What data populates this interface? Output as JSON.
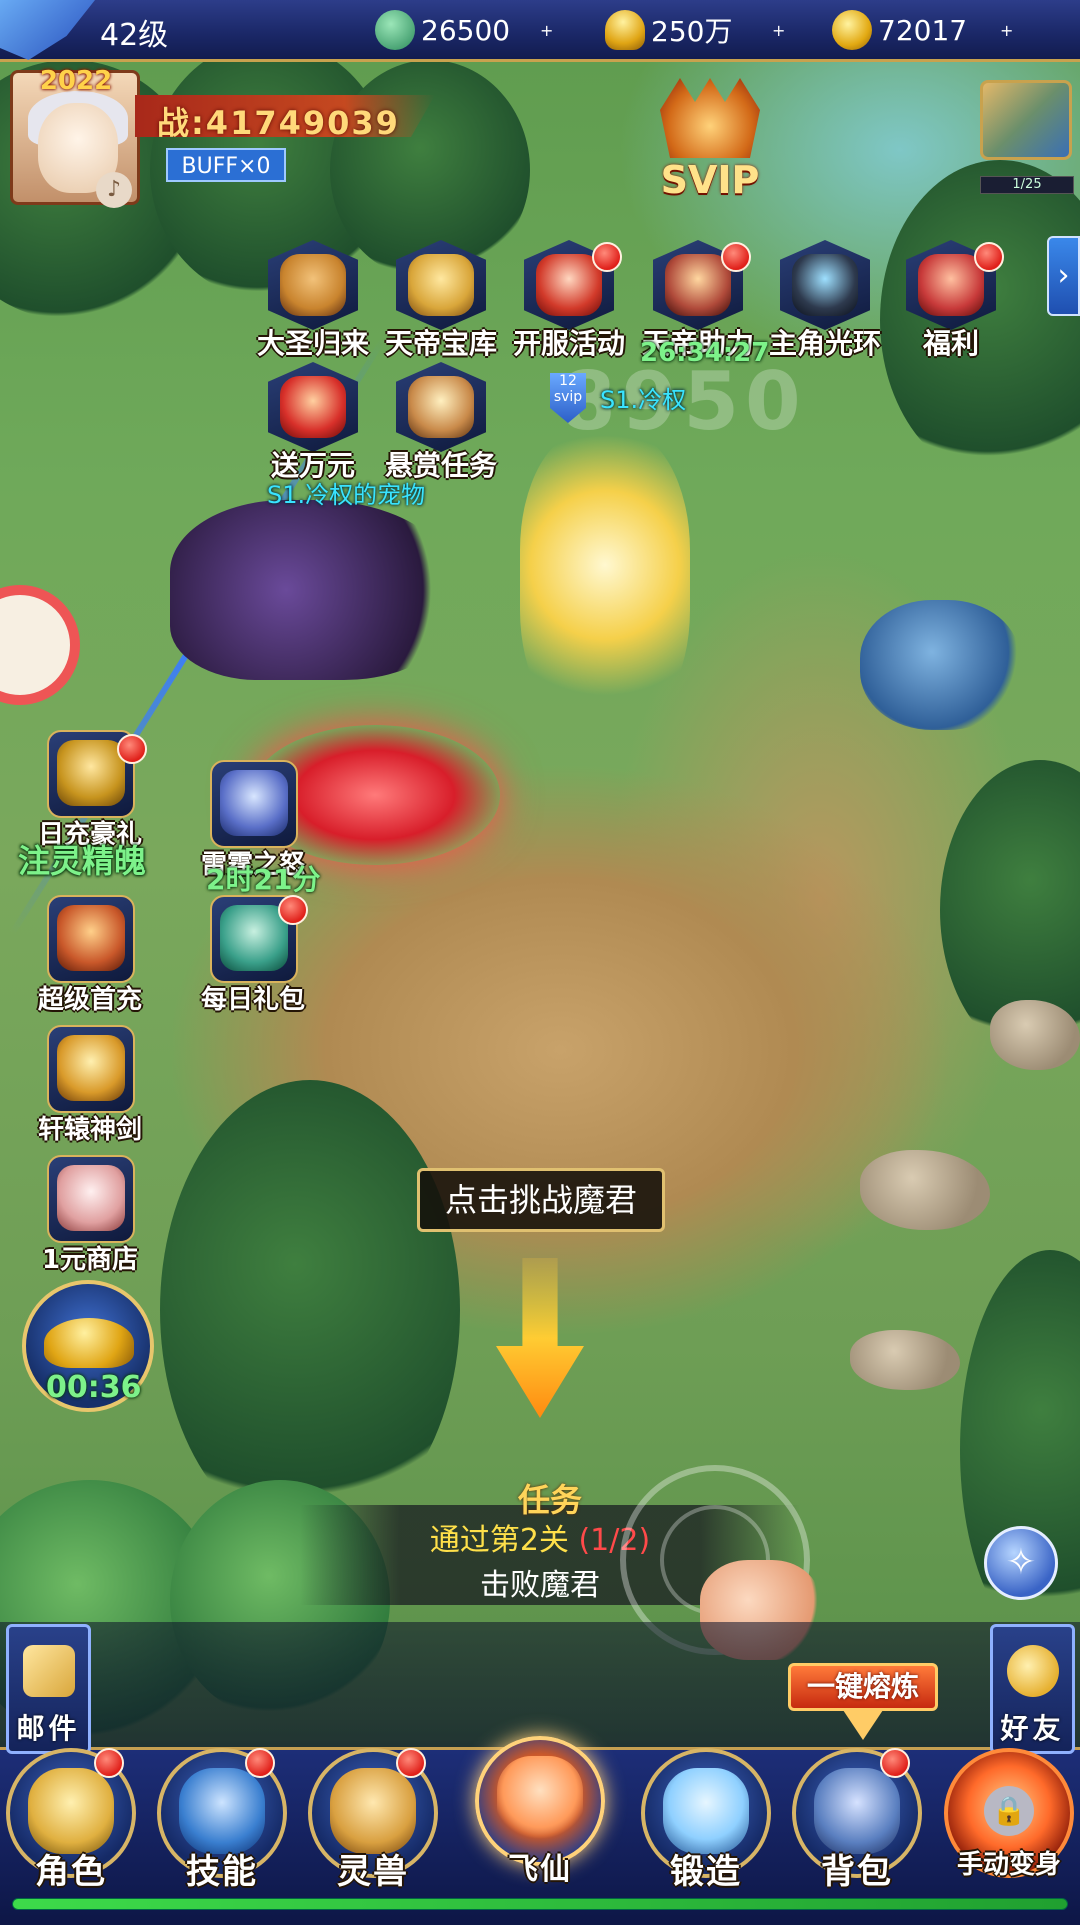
{
  "header": {
    "level": "42级",
    "resources": [
      {
        "name": "jade",
        "icon": "jade-icon",
        "value": "26500",
        "color": "#3aa36a"
      },
      {
        "name": "gold-ingot",
        "icon": "gold-ingot-icon",
        "value": "250万",
        "color": "#e9b52a"
      },
      {
        "name": "coin",
        "icon": "coin-icon",
        "value": "72017",
        "color": "#f2c230"
      }
    ],
    "plus_symbol": "+"
  },
  "player": {
    "year_badge": "2022",
    "power": "战:41749039",
    "buff": "BUFF×0",
    "speaker_icon": "speaker-icon"
  },
  "svip": {
    "label": "SVIP"
  },
  "map": {
    "progress": "1/25"
  },
  "activities": [
    {
      "label": "大圣归来",
      "icon": "monkey-king-icon",
      "color": "#c9842e",
      "dot": false
    },
    {
      "label": "天帝宝库",
      "icon": "treasure-beast-icon",
      "color": "#d9a63a",
      "dot": false
    },
    {
      "label": "开服活动",
      "icon": "open-server-icon",
      "color": "#d23a2a",
      "dot": true
    },
    {
      "label": "天帝助力",
      "icon": "sky-emperor-icon",
      "color": "#b04a3a",
      "dot": true
    },
    {
      "label": "主角光环",
      "icon": "hero-halo-icon",
      "color": "#2e3a4e",
      "dot": false
    },
    {
      "label": "福利",
      "icon": "fortune-bag-icon",
      "color": "#c83a3a",
      "dot": true
    },
    {
      "label": "送万元",
      "icon": "red-envelope-icon",
      "color": "#d8302a",
      "dot": false
    },
    {
      "label": "悬赏任务",
      "icon": "bounty-scroll-icon",
      "color": "#c98a4a",
      "dot": false
    }
  ],
  "timers": {
    "sky_emperor": "26:34:27",
    "thunder": "2时21分",
    "gold": "00:36"
  },
  "tags": {
    "player_name": "S1.冷权",
    "pet_name": "S1.冷权的宠物",
    "svip_level": "12",
    "svip_small": "svip",
    "ghost_number": "8950"
  },
  "side_icons": [
    {
      "label": "日充豪礼",
      "icon": "daily-recharge-icon",
      "color": "#c7941e",
      "dot": true
    },
    {
      "label": "雷霆之怒",
      "icon": "thunder-wrath-icon",
      "color": "#5a6fc8",
      "dot": false
    },
    {
      "label": "超级首充",
      "icon": "first-recharge-chest-icon",
      "color": "#c9582a",
      "dot": false
    },
    {
      "label": "每日礼包",
      "icon": "daily-gift-bag-icon",
      "color": "#3aa08a",
      "dot": true
    },
    {
      "label": "轩辕神剑",
      "icon": "divine-sword-icon",
      "color": "#d99a2a",
      "dot": false
    },
    {
      "label": "1元商店",
      "icon": "gift-box-shop-icon",
      "color": "#e0a0a0",
      "dot": false
    }
  ],
  "side_green": "注灵精魄",
  "prompt": "点击挑战魔君",
  "quest": {
    "title": "任务",
    "line1": "通过第2关",
    "progress": "(1/2)",
    "line2": "击败魔君"
  },
  "dock": {
    "left": {
      "label": "邮件",
      "icon": "mail-icon"
    },
    "right": {
      "label": "好友",
      "icon": "friends-icon"
    },
    "melt": "一键熔炼",
    "nav": [
      {
        "label": "角色",
        "icon": "character-helmet-icon",
        "color": "#e0b040",
        "dot": true
      },
      {
        "label": "技能",
        "icon": "skill-book-icon",
        "color": "#3a7fd0",
        "dot": true
      },
      {
        "label": "灵兽",
        "icon": "spirit-dragon-icon",
        "color": "#d9a040",
        "dot": true
      },
      {
        "label": "飞仙",
        "icon": "ascend-immortal-icon",
        "color": "#ff9a5a",
        "dot": false
      },
      {
        "label": "锻造",
        "icon": "forge-hammer-icon",
        "color": "#8fd0ff",
        "dot": false
      },
      {
        "label": "背包",
        "icon": "backpack-armor-icon",
        "color": "#5a7fc0",
        "dot": true
      },
      {
        "label": "手动变身",
        "icon": "transform-lock-icon",
        "color": "#ff6a2a",
        "dot": false
      }
    ]
  }
}
